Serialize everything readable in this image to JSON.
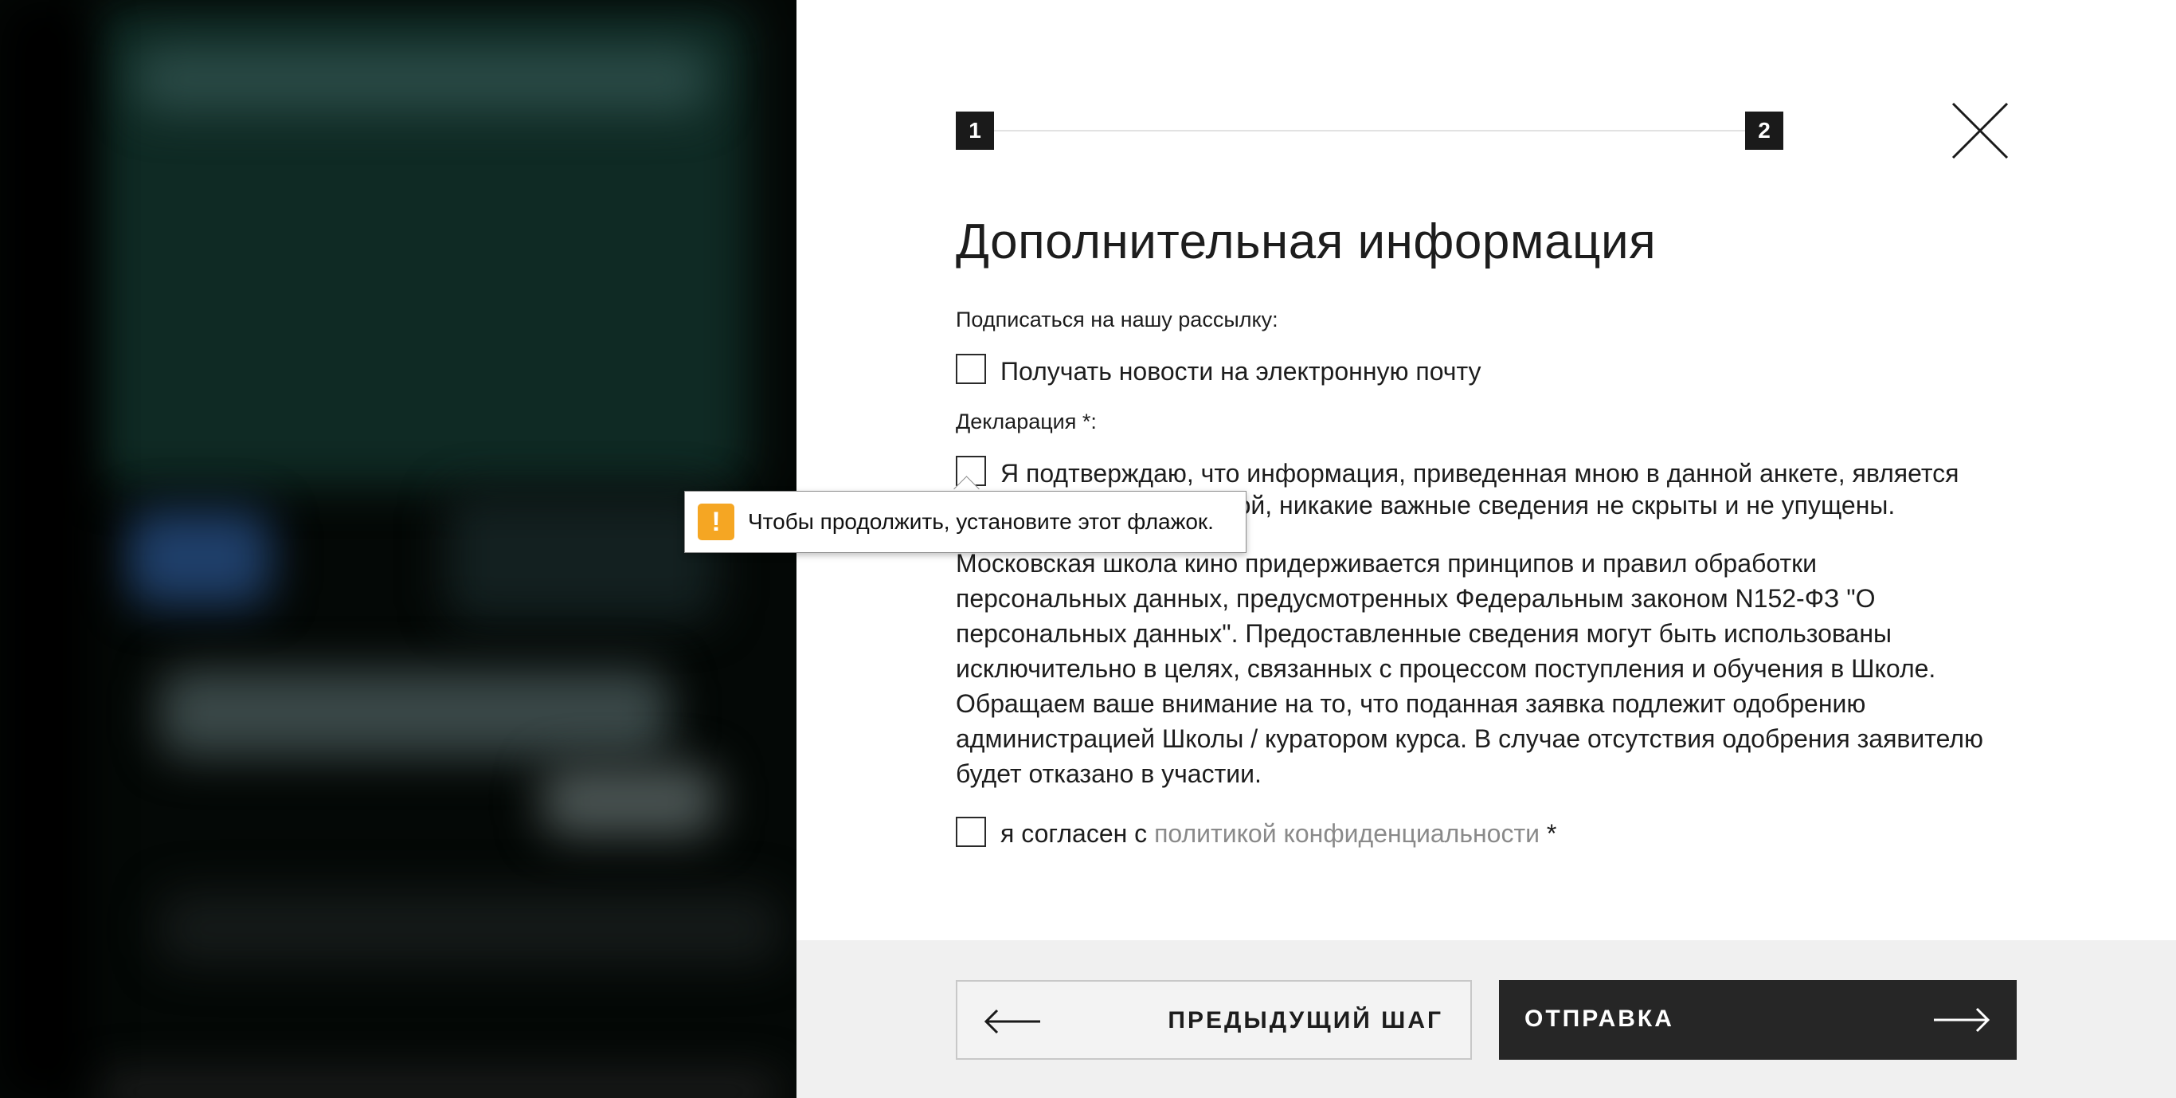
{
  "form": {
    "steps": [
      "1",
      "2"
    ],
    "title": "Дополнительная информация",
    "newsletter": {
      "section_label": "Подписаться на нашу рассылку:",
      "checkbox_label": "Получать новости на электронную почту",
      "checked": false
    },
    "declaration": {
      "section_label": "Декларация *:",
      "checkbox_label_line1": "Я подтверждаю, что информация, приведенная мною в данной анкете, является",
      "checkbox_label_line2": "полной и достоверной, никакие важные сведения не скрыты и не упущены.",
      "checked": false
    },
    "privacy_paragraph": "Московская школа кино придерживается принципов и правил обработки персональных данных, предусмотренных Федеральным законом N152-ФЗ \"О персональных данных\". Предоставленные сведения могут быть использованы исключительно в целях, связанных с процессом поступления и обучения в Школе. Обращаем ваше внимание на то, что поданная заявка подлежит одобрению администрацией Школы / куратором курса. В случае отсутствия одобрения заявителю будет отказано в участии.",
    "consent": {
      "prefix": "я согласен с",
      "link_text": "политикой конфиденциальности",
      "suffix": "*",
      "checked": false
    }
  },
  "validation_tooltip": {
    "icon": "warning-icon",
    "icon_glyph": "!",
    "message": "Чтобы продолжить, установите этот флажок.",
    "color": "#f5a623"
  },
  "footer": {
    "prev_label": "ПРЕДЫДУЩИЙ ШАГ",
    "submit_label": "ОТПРАВКА"
  },
  "colors": {
    "panel_bg": "#ffffff",
    "footer_bg": "#f0f0f0",
    "submit_bg": "#262626",
    "link": "#8a8a8a"
  }
}
